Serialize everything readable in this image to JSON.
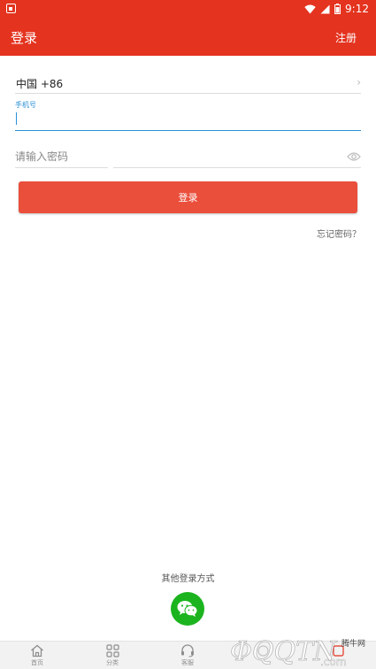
{
  "status": {
    "time": "9:12"
  },
  "header": {
    "title": "登录",
    "register_label": "注册"
  },
  "form": {
    "country_code": "中国 +86",
    "phone_label": "手机号",
    "phone_value": "",
    "password_placeholder": "请输入密码",
    "login_label": "登录",
    "forgot_label": "忘记密码？"
  },
  "other_login": {
    "label": "其他登录方式"
  },
  "bottom_nav": {
    "items": [
      {
        "label": "首页"
      },
      {
        "label": "分类"
      },
      {
        "label": "客服"
      }
    ]
  },
  "watermark": {
    "text": "腾牛网"
  },
  "colors": {
    "brand": "#e4331f",
    "button": "#ea4f3c",
    "focus": "#2a8fd6",
    "wechat": "#1bb41e"
  }
}
